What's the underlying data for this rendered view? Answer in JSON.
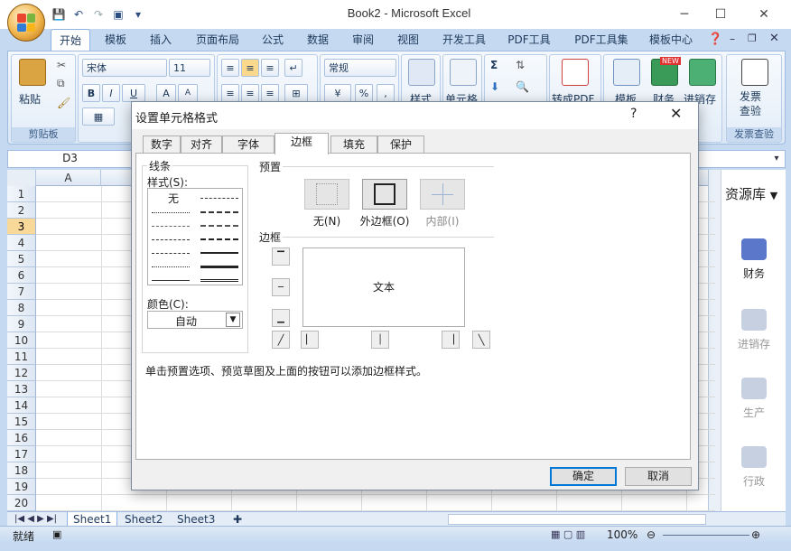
{
  "window": {
    "title": "Book2 - Microsoft Excel"
  },
  "ribbon_tabs": [
    "开始",
    "模板",
    "插入",
    "页面布局",
    "公式",
    "数据",
    "审阅",
    "视图",
    "开发工具",
    "PDF工具",
    "PDF工具集",
    "模板中心"
  ],
  "ribbon": {
    "paste_label": "粘贴",
    "clipboard_group": "剪贴板",
    "font_name": "宋体",
    "font_size": "11",
    "number_format": "常规",
    "style_label": "样式",
    "cell_label": "单元格",
    "topdf_label": "转成PDF",
    "template_label": "模板",
    "finance_label": "财务",
    "inventory_label": "进销存",
    "invoice_label": "发票\n查验",
    "invoice_group": "发票查验",
    "new_badge": "NEW",
    "percent": "%"
  },
  "namebox": "D3",
  "grid": {
    "columns": [
      "A"
    ],
    "rows": [
      "1",
      "2",
      "3",
      "4",
      "5",
      "6",
      "7",
      "8",
      "9",
      "10",
      "11",
      "12",
      "13",
      "14",
      "15",
      "16",
      "17",
      "18",
      "19",
      "20"
    ],
    "selected_row": "3"
  },
  "side_panel": {
    "title": "资源库",
    "items": [
      "财务",
      "进销存",
      "生产",
      "行政"
    ]
  },
  "sheets": [
    "Sheet1",
    "Sheet2",
    "Sheet3"
  ],
  "status": {
    "ready": "就绪",
    "zoom": "100%"
  },
  "dialog": {
    "title": "设置单元格格式",
    "help": "?",
    "tabs": [
      "数字",
      "对齐",
      "字体",
      "边框",
      "填充",
      "保护"
    ],
    "active_tab": "边框",
    "line_group": "线条",
    "style_label": "样式(S):",
    "none_style": "无",
    "color_label": "颜色(C):",
    "color_value": "自动",
    "presets_group": "预置",
    "preset_none": "无(N)",
    "preset_outline": "外边框(O)",
    "preset_inside": "内部(I)",
    "border_group": "边框",
    "preview_text": "文本",
    "hint": "单击预置选项、预览草图及上面的按钮可以添加边框样式。",
    "ok": "确定",
    "cancel": "取消"
  }
}
